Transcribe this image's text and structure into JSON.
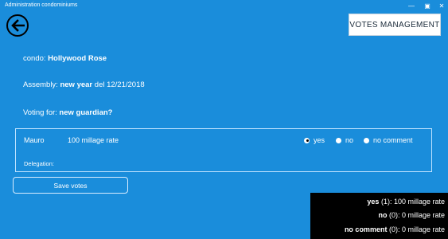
{
  "window": {
    "title": "Administration condominiums",
    "minimize": "—",
    "maximize": "▣",
    "close": "✕"
  },
  "header": {
    "votes_management_label": "VOTES MANAGEMENT"
  },
  "info": {
    "condo_label": "condo:",
    "condo_value": "Hollywood Rose",
    "assembly_label": "Assembly:",
    "assembly_name": "new year",
    "assembly_suffix": "del 12/21/2018",
    "voting_label": "Voting for:",
    "voting_value": "new guardian?"
  },
  "vote_panel": {
    "owner_name": "Mauro",
    "millage": "100 millage rate",
    "delegation_label": "Delegation:",
    "options": [
      {
        "label": "yes",
        "selected": true
      },
      {
        "label": "no",
        "selected": false
      },
      {
        "label": "no comment",
        "selected": false
      }
    ]
  },
  "save_label": "Save votes",
  "summary": [
    {
      "label": "yes",
      "count": "(1): 100 millage rate"
    },
    {
      "label": "no",
      "count": "(0): 0 millage rate"
    },
    {
      "label": "no comment",
      "count": "(0): 0 millage rate"
    }
  ],
  "colors": {
    "background": "#1a8ddb",
    "summary_bg": "#000000"
  }
}
